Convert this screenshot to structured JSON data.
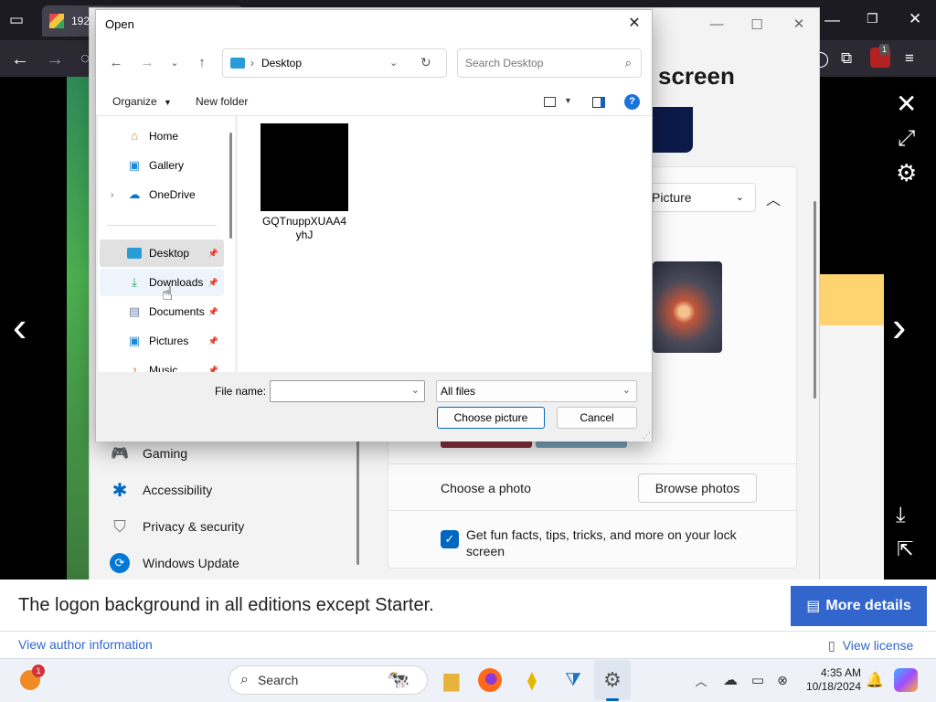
{
  "browser": {
    "tab_title": "1920",
    "extension_badge": "1"
  },
  "settings": {
    "title_fragment": "screen",
    "dropdown_value": "Picture",
    "nav_items": [
      {
        "label": "Gaming",
        "icon": "gaming-icon"
      },
      {
        "label": "Accessibility",
        "icon": "accessibility-icon"
      },
      {
        "label": "Privacy & security",
        "icon": "shield-icon"
      },
      {
        "label": "Windows Update",
        "icon": "update-icon"
      }
    ],
    "choose_photo_label": "Choose a photo",
    "browse_photos_label": "Browse photos",
    "fun_facts_label": "Get fun facts, tips, tricks, and more on your lock screen",
    "fun_facts_checked": true
  },
  "dialog": {
    "title": "Open",
    "address_location": "Desktop",
    "search_placeholder": "Search Desktop",
    "organize_label": "Organize",
    "new_folder_label": "New folder",
    "nav_pane": [
      {
        "label": "Home",
        "icon": "home-icon"
      },
      {
        "label": "Gallery",
        "icon": "gallery-icon"
      },
      {
        "label": "OneDrive",
        "icon": "onedrive-icon",
        "expandable": true
      },
      {
        "label": "Desktop",
        "icon": "desktop-icon",
        "pinned": true,
        "selected": true
      },
      {
        "label": "Downloads",
        "icon": "download-icon",
        "pinned": true,
        "hovered": true
      },
      {
        "label": "Documents",
        "icon": "document-icon",
        "pinned": true
      },
      {
        "label": "Pictures",
        "icon": "pictures-icon",
        "pinned": true
      },
      {
        "label": "Music",
        "icon": "music-icon",
        "pinned": true
      }
    ],
    "file": {
      "name_line1": "GQTnuppXUAA4",
      "name_line2": "yhJ"
    },
    "filename_label": "File name:",
    "filename_value": "",
    "filetype_value": "All files",
    "choose_button": "Choose picture",
    "cancel_button": "Cancel"
  },
  "info_bar": {
    "caption": "The logon background in all editions except Starter.",
    "more_details": "More details",
    "author_link": "View author information",
    "license_link": "View license"
  },
  "taskbar": {
    "search_label": "Search",
    "notification_badge": "1",
    "time": "4:35 AM",
    "date": "10/18/2024"
  },
  "colors": {
    "accent": "#0067c0",
    "more_details_bg": "#3366cc",
    "link": "#3366cc"
  }
}
